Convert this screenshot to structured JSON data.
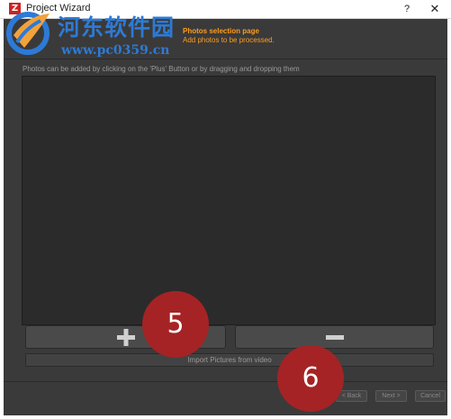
{
  "window": {
    "app_icon": "Z",
    "title": "Project Wizard",
    "help_label": "?",
    "close_label": "✕"
  },
  "header": {
    "title": "Photos selection page",
    "subtitle": "Add photos to be processed."
  },
  "instructions": "Photos can be added by clicking on the 'Plus' Button or by dragging and dropping them",
  "buttons": {
    "plus_icon": "plus-icon",
    "minus_icon": "minus-icon",
    "import_label": "Import Pictures from video",
    "back_label": "< Back",
    "next_label": "Next >",
    "cancel_label": "Cancel"
  },
  "annotations": {
    "marker_5": "5",
    "marker_6": "6"
  },
  "watermark": {
    "top_text": "河东软件园",
    "bottom_text": "www.pc0359.cn"
  },
  "colors": {
    "accent": "#ff9d1e",
    "dialog_bg": "#3a3a3a",
    "marker": "#a52324",
    "watermark": "#2d7ad6"
  }
}
